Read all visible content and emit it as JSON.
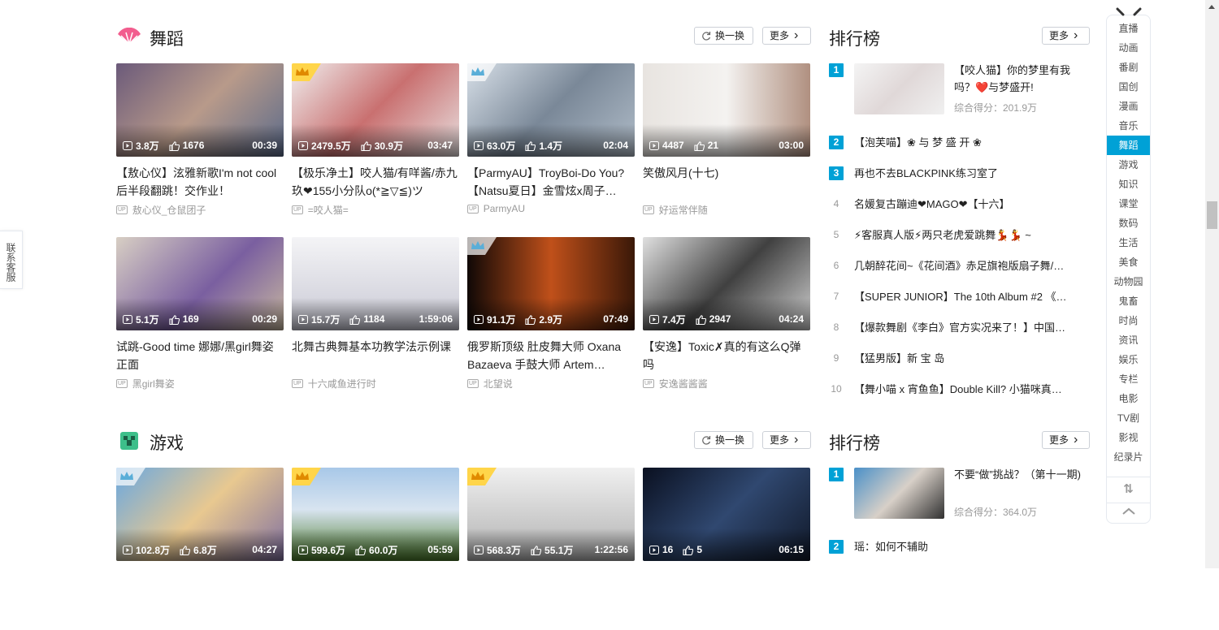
{
  "sections": [
    {
      "title": "舞蹈",
      "icon": "fan-icon",
      "refresh_label": "换一换",
      "more_label": "更多",
      "videos": [
        {
          "views": "3.8万",
          "likes": "1676",
          "duration": "00:39",
          "title": "【敖心仪】泫雅新歌I'm not cool后半段翻跳！交作业！",
          "uploader": "敖心仪_仓鼠团子",
          "badge": "none",
          "bg": "linear-gradient(135deg,#6b5a7a,#b89a8a 50%,#5a6a8a)"
        },
        {
          "views": "2479.5万",
          "likes": "30.9万",
          "duration": "03:47",
          "title": "【极乐净土】咬人猫/有咩酱/赤九玖❤155小分队o(*≧▽≦)ツ",
          "uploader": "=咬人猫=",
          "badge": "gold",
          "bg": "linear-gradient(135deg,#f0eeee,#c97070 50%,#e8e0e0)"
        },
        {
          "views": "63.0万",
          "likes": "1.4万",
          "duration": "02:04",
          "title": "【ParmyAU】TroyBoi-Do You?【Natsu夏日】金雪炫x周子…",
          "uploader": "ParmyAU",
          "badge": "blue",
          "bg": "linear-gradient(135deg,#d8e0e8,#7a8898 50%,#b0bcc8)"
        },
        {
          "views": "4487",
          "likes": "21",
          "duration": "03:00",
          "title": "笑傲风月(十七)",
          "uploader": "好运常伴随",
          "badge": "none",
          "bg": "linear-gradient(90deg,#e8e4e0,#f4f2f0 50%,#b09080)"
        },
        {
          "views": "5.1万",
          "likes": "169",
          "duration": "00:29",
          "title": "试跳-Good time 娜娜/黑girl舞姿正面",
          "uploader": "黑girl舞姿",
          "badge": "none",
          "bg": "linear-gradient(135deg,#d8cfc4,#7a5fa0 55%,#c8b8a0)"
        },
        {
          "views": "15.7万",
          "likes": "1184",
          "duration": "1:59:06",
          "title": "北舞古典舞基本功教学法示例课",
          "uploader": "十六咸鱼进行时",
          "badge": "none",
          "bg": "linear-gradient(180deg,#f4f4f6,#c8c8d4)"
        },
        {
          "views": "91.1万",
          "likes": "2.9万",
          "duration": "07:49",
          "title": "俄罗斯顶级 肚皮舞大师 Oxana Bazaeva 手鼓大师 Artem…",
          "uploader": "北望说",
          "badge": "blue",
          "bg": "linear-gradient(90deg,#100806,#c0501a 50%,#3a1808)"
        },
        {
          "views": "7.4万",
          "likes": "2947",
          "duration": "04:24",
          "title": "【安逸】Toxic✗真的有这么Q弹吗",
          "uploader": "安逸酱酱酱",
          "badge": "none",
          "bg": "linear-gradient(135deg,#e0e0e0,#404040 50%,#d0d0d0)"
        }
      ],
      "ranking": {
        "title": "排行榜",
        "more_label": "更多",
        "score_label": "综合得分：201.9万",
        "items": [
          {
            "rank": "1",
            "title": "【咬人猫】你的梦里有我吗？❤️与梦盛开!"
          },
          {
            "rank": "2",
            "title": "【泡芙喵】❀ 与 梦 盛 开 ❀"
          },
          {
            "rank": "3",
            "title": "再也不去BLACKPINK练习室了"
          },
          {
            "rank": "4",
            "title": "名媛复古蹦迪❤MAGO❤【十六】"
          },
          {
            "rank": "5",
            "title": "⚡客服真人版⚡两只老虎爱跳舞💃💃 ~"
          },
          {
            "rank": "6",
            "title": "几朝醉花间~《花间酒》赤足旗袍版扇子舞/…"
          },
          {
            "rank": "7",
            "title": "【SUPER JUNIOR】The 10th Album #2 《…"
          },
          {
            "rank": "8",
            "title": "【爆款舞剧《李白》官方实况来了！】中国…"
          },
          {
            "rank": "9",
            "title": "【猛男版】新 宝 岛"
          },
          {
            "rank": "10",
            "title": "【舞小喵 x 宵鱼鱼】Double Kill? 小猫咪真…"
          }
        ]
      }
    },
    {
      "title": "游戏",
      "icon": "creeper-icon",
      "refresh_label": "换一换",
      "more_label": "更多",
      "videos": [
        {
          "views": "102.8万",
          "likes": "6.8万",
          "duration": "04:27",
          "title": "",
          "uploader": "",
          "badge": "blue",
          "bg": "linear-gradient(135deg,#6aa8e0,#e8c890 50%,#8070a0)"
        },
        {
          "views": "599.6万",
          "likes": "60.0万",
          "duration": "05:59",
          "title": "",
          "uploader": "",
          "badge": "gold",
          "bg": "linear-gradient(180deg,#a8c8e8,#d8e4f0 45%,#4a7a2a)"
        },
        {
          "views": "568.3万",
          "likes": "55.1万",
          "duration": "1:22:56",
          "title": "",
          "uploader": "",
          "badge": "gold",
          "bg": "linear-gradient(180deg,#f0f0f0,#b0b0b0)"
        },
        {
          "views": "16",
          "likes": "5",
          "duration": "06:15",
          "title": "",
          "uploader": "",
          "badge": "none",
          "bg": "linear-gradient(135deg,#0a1020,#304870 50%,#101828)"
        }
      ],
      "ranking": {
        "title": "排行榜",
        "more_label": "更多",
        "score_label": "综合得分：364.0万",
        "items": [
          {
            "rank": "1",
            "title": "不要“做”挑战？（第十一期)"
          },
          {
            "rank": "2",
            "title": "瑶：如何不辅助"
          }
        ]
      }
    }
  ],
  "nav": {
    "active": "舞蹈",
    "items": [
      "直播",
      "动画",
      "番剧",
      "国创",
      "漫画",
      "音乐",
      "舞蹈",
      "游戏",
      "知识",
      "课堂",
      "数码",
      "生活",
      "美食",
      "动物园",
      "鬼畜",
      "时尚",
      "资讯",
      "娱乐",
      "专栏",
      "电影",
      "TV剧",
      "影视",
      "纪录片"
    ]
  },
  "contact_label": "联系客服",
  "colors": {
    "accent": "#00a1d6",
    "gold_badge": "#ffd700"
  }
}
